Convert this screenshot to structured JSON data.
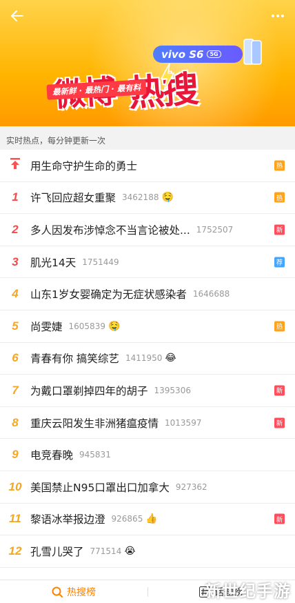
{
  "banner": {
    "title_part1": "微博",
    "title_part2": "热搜",
    "slogan": "最新鲜 · 最热门 · 最有料",
    "brand": "vivo S6",
    "brand_tag": "5G"
  },
  "subheader": {
    "text": "实时热点，每分钟更新一次"
  },
  "list": [
    {
      "rank": "",
      "title": "用生命守护生命的勇士",
      "count": "",
      "emoji": "",
      "badge": "热",
      "badge_type": "hot"
    },
    {
      "rank": "1",
      "title": "许飞回应超女重聚",
      "count": "3462188",
      "emoji": "🤤",
      "badge": "热",
      "badge_type": "hot"
    },
    {
      "rank": "2",
      "title": "多人因发布涉悼念不当言论被处...",
      "count": "1752507",
      "emoji": "",
      "badge": "新",
      "badge_type": "new"
    },
    {
      "rank": "3",
      "title": "肌光14天",
      "count": "1751449",
      "emoji": "",
      "badge": "荐",
      "badge_type": "rec"
    },
    {
      "rank": "4",
      "title": "山东1岁女婴确定为无症状感染者",
      "count": "1646688",
      "emoji": "",
      "badge": "",
      "badge_type": ""
    },
    {
      "rank": "5",
      "title": "尚雯婕",
      "count": "1605839",
      "emoji": "🤤",
      "badge": "热",
      "badge_type": "hot"
    },
    {
      "rank": "6",
      "title": "青春有你 搞笑综艺",
      "count": "1411950",
      "emoji": "😂",
      "badge": "",
      "badge_type": ""
    },
    {
      "rank": "7",
      "title": "为戴口罩剃掉四年的胡子",
      "count": "1395306",
      "emoji": "",
      "badge": "新",
      "badge_type": "new"
    },
    {
      "rank": "8",
      "title": "重庆云阳发生非洲猪瘟疫情",
      "count": "1013597",
      "emoji": "",
      "badge": "新",
      "badge_type": "new"
    },
    {
      "rank": "9",
      "title": "电竞春晚",
      "count": "945831",
      "emoji": "",
      "badge": "",
      "badge_type": ""
    },
    {
      "rank": "10",
      "title": "美国禁止N95口罩出口加拿大",
      "count": "927362",
      "emoji": "",
      "badge": "",
      "badge_type": ""
    },
    {
      "rank": "11",
      "title": "黎语冰举报边澄",
      "count": "926865",
      "emoji": "👍",
      "badge": "新",
      "badge_type": "new"
    },
    {
      "rank": "12",
      "title": "孔雪儿哭了",
      "count": "771514",
      "emoji": "😭",
      "badge": "",
      "badge_type": ""
    }
  ],
  "tabs": [
    {
      "label": "热搜榜",
      "icon": "search-hot-icon",
      "active": true
    },
    {
      "label": "话题榜",
      "icon": "hashtag-icon",
      "active": false
    }
  ],
  "watermark": "新世纪手游",
  "colors": {
    "accent": "#ff8200",
    "hot": "#ffa41a",
    "new": "#ff4d5c",
    "rec": "#44a5ff",
    "rank_top": "#f34a4a",
    "rank_other": "#f5a623"
  }
}
